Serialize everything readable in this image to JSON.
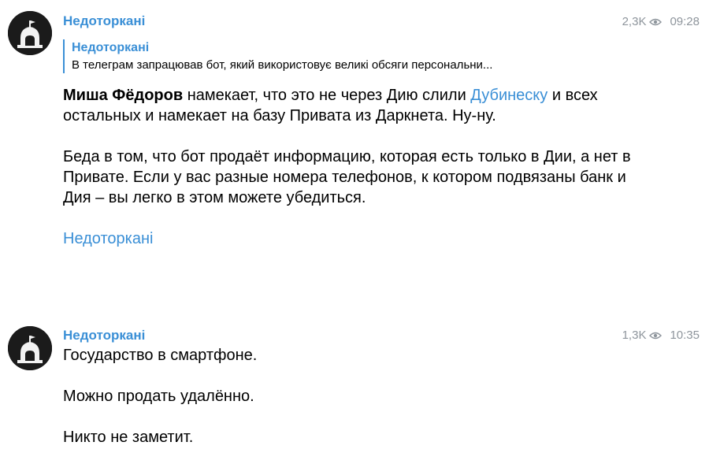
{
  "messages": [
    {
      "sender": "Недоторкані",
      "views": "2,3K",
      "time": "09:28",
      "reply": {
        "name": "Недоторкані",
        "text": "В телеграм запрацював бот, який використовує великі обсяги персональни..."
      },
      "body": {
        "p1_bold": "Миша Фёдоров",
        "p1_text_a": " намекает, что это не через Дию слили ",
        "p1_link": "Дубинеску",
        "p1_text_b": " и всех остальных и намекает на базу Привата из Даркнета. Ну-ну.",
        "p2": "Беда в том, что бот продаёт информацию, которая есть только в Дии, а нет в Привате. Если у вас разные номера телефонов, к котором подвязаны банк и Дия – вы легко в этом можете убедиться.",
        "signature_link": "Недоторкані"
      }
    },
    {
      "sender": "Недоторкані",
      "views": "1,3K",
      "time": "10:35",
      "body": {
        "p1": "Государство в смартфоне.",
        "p2": "Можно продать удалённо.",
        "p3": "Никто не заметит."
      }
    }
  ],
  "colors": {
    "accent": "#3a8fd6",
    "meta": "#8e959c",
    "avatar_bg": "#1b1b1b"
  },
  "icons": {
    "views": "eye-icon",
    "avatar": "bell-tower-avatar"
  }
}
